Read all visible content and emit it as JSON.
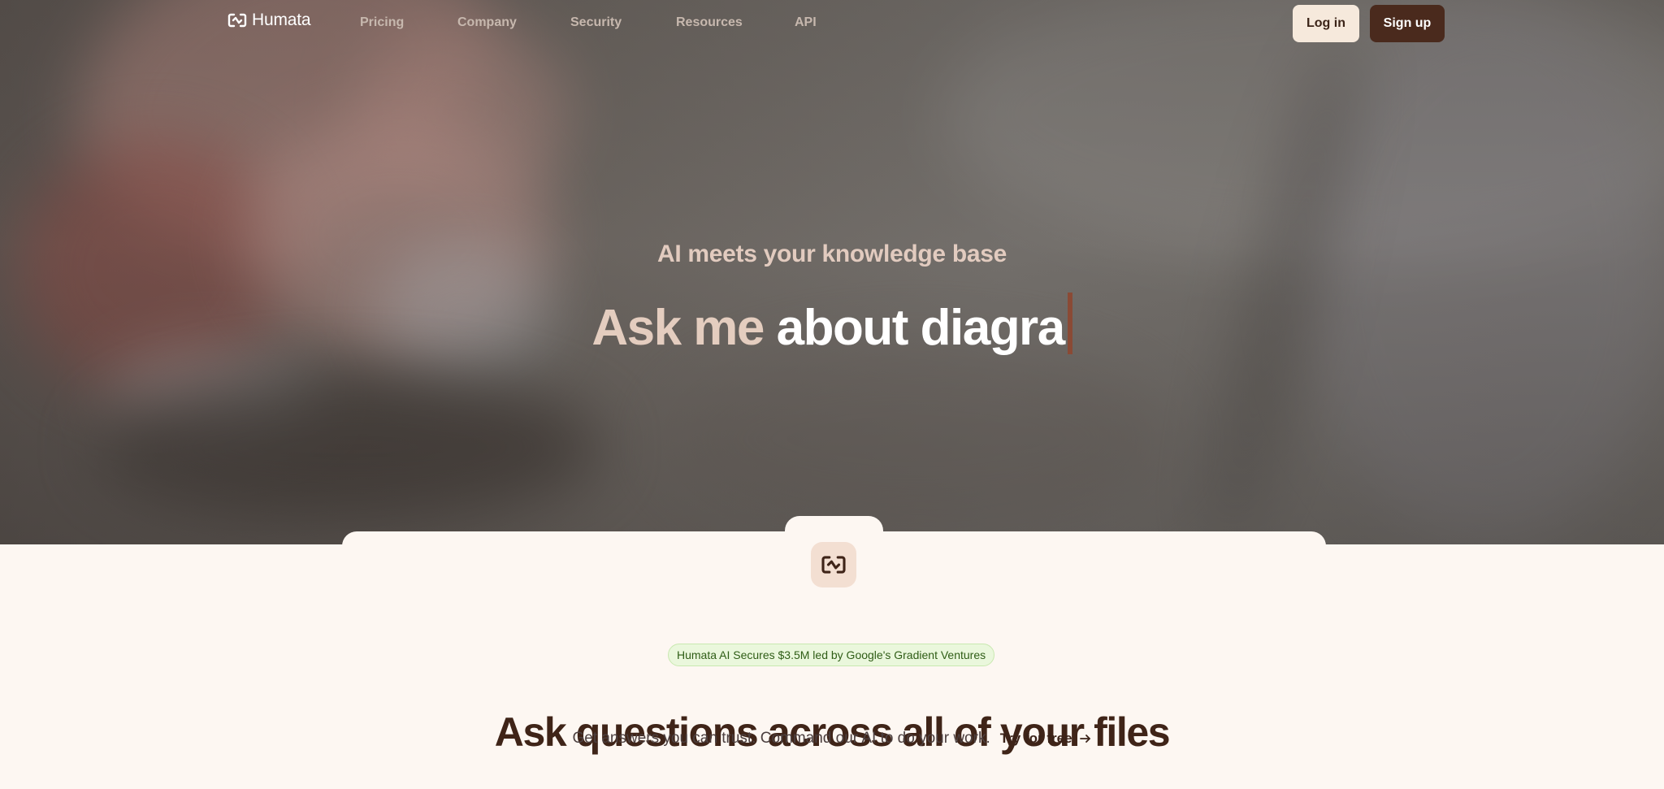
{
  "brand": {
    "name": "Humata",
    "logo_icon": "humata-logo-icon"
  },
  "nav": {
    "links": [
      {
        "label": "Pricing"
      },
      {
        "label": "Company"
      },
      {
        "label": "Security"
      },
      {
        "label": "Resources"
      },
      {
        "label": "API"
      }
    ],
    "login_label": "Log in",
    "signup_label": "Sign up"
  },
  "hero": {
    "subtitle": "AI meets your knowledge base",
    "title_lead": "Ask me",
    "title_typed": "about diagra",
    "caret_color": "#8a4a35"
  },
  "section": {
    "news_badge": "Humata AI Secures $3.5M led by Google's Gradient Ventures",
    "title": "Ask questions across all of your files",
    "tagline": "Get answers you can trust. Command our AI to do your work.",
    "cta_label": "Try for free",
    "cta_icon": "arrow-right-icon"
  },
  "colors": {
    "brand_dark": "#4a2a1d",
    "login_bg": "#f6e9dc",
    "page_bg": "#fdf7f2",
    "badge_green": "#eaf7dc"
  }
}
